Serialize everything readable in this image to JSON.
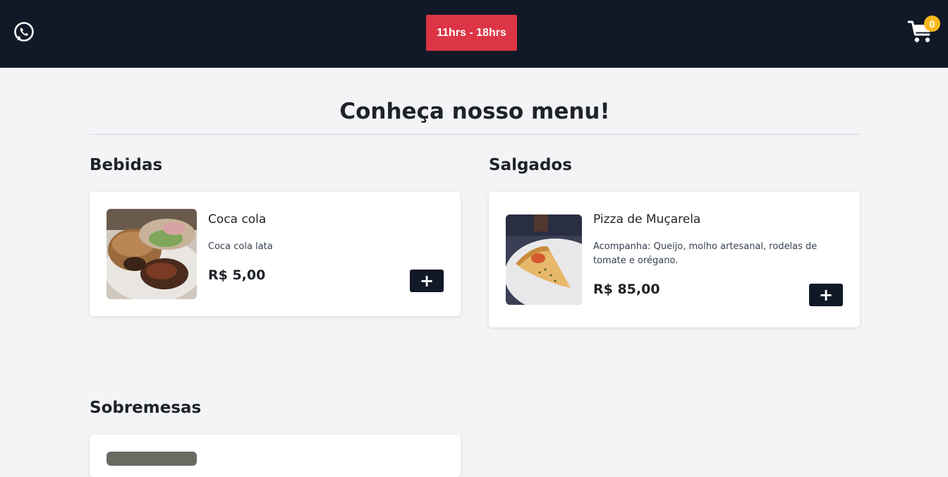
{
  "header": {
    "whatsapp_icon": "whatsapp-icon",
    "hours": "11hrs - 18hrs",
    "cart_icon": "shopping-cart-icon",
    "cart_count": "0"
  },
  "page": {
    "title": "Conheça nosso menu!"
  },
  "sections": [
    {
      "title": "Bebidas",
      "items": [
        {
          "name": "Coca cola",
          "description": "Coca cola lata",
          "price": "R$ 5,00",
          "add_label": "+"
        }
      ]
    },
    {
      "title": "Salgados",
      "items": [
        {
          "name": "Pizza de Muçarela",
          "description": "Acompanha: Queijo, molho artesanal, rodelas de tomate e orégano.",
          "price": "R$ 85,00",
          "add_label": "+"
        }
      ]
    },
    {
      "title": "Sobremesas",
      "items": []
    }
  ],
  "colors": {
    "header_bg": "#111827",
    "hours_badge": "#dc3545",
    "cart_badge": "#f5b81c",
    "page_bg": "#f3f4f6"
  }
}
